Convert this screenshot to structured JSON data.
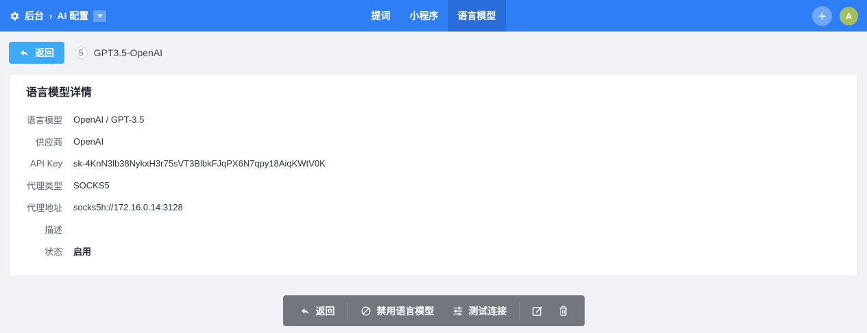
{
  "header": {
    "home_label": "后台",
    "breadcrumb_separator": "›",
    "section_label": "AI 配置",
    "tabs": [
      {
        "label": "提词",
        "active": false
      },
      {
        "label": "小程序",
        "active": false
      },
      {
        "label": "语言模型",
        "active": true
      }
    ],
    "avatar_letter": "A"
  },
  "record_bar": {
    "back_label": "返回",
    "record_id": "5",
    "record_name": "GPT3.5-OpenAI"
  },
  "detail": {
    "title": "语言模型详情",
    "fields": [
      {
        "label": "语言模型",
        "value": "OpenAI / GPT-3.5"
      },
      {
        "label": "供应商",
        "value": "OpenAI"
      },
      {
        "label": "API Key",
        "value": "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"
      },
      {
        "label": "代理类型",
        "value": "SOCKS5"
      },
      {
        "label": "代理地址",
        "value": "socks5h://172.16.0.14:3128"
      },
      {
        "label": "描述",
        "value": ""
      },
      {
        "label": "状态",
        "value": "启用"
      }
    ]
  },
  "action_bar": {
    "back_label": "返回",
    "disable_label": "禁用语言模型",
    "test_label": "测试连接"
  },
  "icons": {
    "gear_icon": "⚙",
    "chevron_down_icon": "▾",
    "plus_icon": "+",
    "back_arrow_icon": "↶",
    "ban_icon": "⊘",
    "sliders_icon": "☰",
    "edit_icon": "✎",
    "trash_icon": "🗑"
  },
  "colors": {
    "header_blue": "#2e7ff5",
    "active_tab_blue": "#2a6cd9",
    "back_button_blue": "#3cabf3",
    "avatar_green": "#a4c05e",
    "toolbar_gray": "#72777e",
    "page_background": "#f0f2f5"
  }
}
